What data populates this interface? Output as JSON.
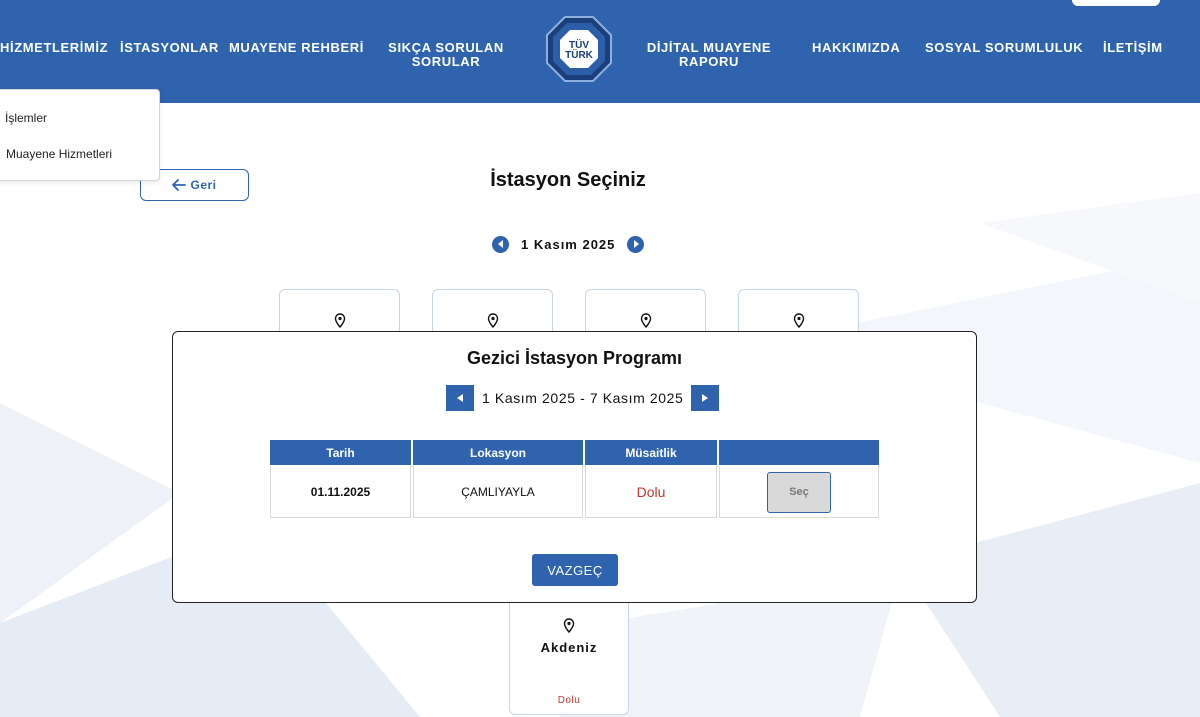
{
  "header": {
    "nav": [
      {
        "label": "HİZMETLERİMİZ"
      },
      {
        "label": "İSTASYONLAR"
      },
      {
        "label": "MUAYENE REHBERİ"
      },
      {
        "label": "SIKÇA SORULAN SORULAR"
      },
      {
        "label": "DİJİTAL MUAYENE RAPORU"
      },
      {
        "label": "HAKKIMIZDA"
      },
      {
        "label": "SOSYAL SORUMLULUK"
      },
      {
        "label": "İLETİŞİM"
      }
    ],
    "logo_text_top": "TÜV",
    "logo_text_bottom": "TÜRK"
  },
  "dropdown": {
    "items": [
      {
        "label": "İşlemler"
      },
      {
        "label": "Muayene Hizmetleri"
      }
    ]
  },
  "back_label": "Geri",
  "page_title": "İstasyon Seçiniz",
  "date_nav": {
    "date": "1 Kasım 2025"
  },
  "bottom_card": {
    "name": "Akdeniz",
    "status": "Dolu"
  },
  "modal": {
    "title": "Gezici İstasyon Programı",
    "week_range": "1 Kasım 2025 - 7 Kasım 2025",
    "columns": [
      "Tarih",
      "Lokasyon",
      "Müsaitlik",
      ""
    ],
    "rows": [
      {
        "date": "01.11.2025",
        "location": "ÇAMLIYAYLA",
        "availability": "Dolu",
        "action": "Seç"
      }
    ],
    "cancel_label": "VAZGEÇ"
  },
  "colors": {
    "brand": "#3063ad",
    "full": "#c0392b"
  }
}
